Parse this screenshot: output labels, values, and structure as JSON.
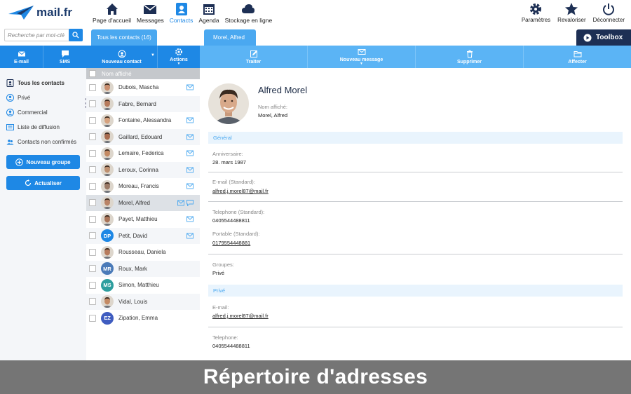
{
  "brand": {
    "name": "mail.fr",
    "accent": "#1e88e5",
    "dark": "#1d2f54"
  },
  "topnav": [
    {
      "label": "Page d'accueil",
      "icon": "home-icon"
    },
    {
      "label": "Messages",
      "icon": "envelope-icon"
    },
    {
      "label": "Contacts",
      "icon": "contacts-icon",
      "active": true
    },
    {
      "label": "Agenda",
      "icon": "calendar-icon"
    },
    {
      "label": "Stockage en ligne",
      "icon": "cloud-icon"
    }
  ],
  "topright": [
    {
      "label": "Paramètres",
      "icon": "gear-icon"
    },
    {
      "label": "Revaloriser",
      "icon": "star-icon"
    },
    {
      "label": "Déconnecter",
      "icon": "power-icon"
    }
  ],
  "search": {
    "placeholder": "Recherche par mot-clé"
  },
  "tabs": {
    "all_contacts": "Tous les contacts (16)",
    "current": "Morel, Alfred"
  },
  "toolbox": {
    "label": "Toolbox"
  },
  "toolbar_left": [
    {
      "label": "E-mail",
      "icon": "envelope-icon"
    },
    {
      "label": "SMS",
      "icon": "sms-icon"
    },
    {
      "label": "Nouveau contact",
      "icon": "add-contact-icon"
    },
    {
      "label": "Actions",
      "icon": "gear-icon"
    }
  ],
  "toolbar_right": [
    {
      "label": "Traiter",
      "icon": "edit-icon"
    },
    {
      "label": "Nouveau message",
      "icon": "envelope-icon"
    },
    {
      "label": "Supprimer",
      "icon": "trash-icon"
    },
    {
      "label": "Affecter",
      "icon": "folder-icon"
    }
  ],
  "sidebar": {
    "items": [
      {
        "label": "Tous les contacts",
        "icon": "address-book-icon"
      },
      {
        "label": "Privé",
        "icon": "user-circle-icon"
      },
      {
        "label": "Commercial",
        "icon": "user-circle-icon"
      },
      {
        "label": "Liste de diffusion",
        "icon": "list-icon"
      },
      {
        "label": "Contacts non confirmés",
        "icon": "users-icon"
      }
    ],
    "new_group": "Nouveau groupe",
    "refresh": "Actualiser"
  },
  "list": {
    "header": "Nom affiché",
    "rows": [
      {
        "name": "Dubois, Mascha",
        "initials": "",
        "mail": true
      },
      {
        "name": "Fabre, Bernard",
        "initials": "",
        "mail": false
      },
      {
        "name": "Fontaine, Alessandra",
        "initials": "",
        "mail": true
      },
      {
        "name": "Gaillard, Edouard",
        "initials": "",
        "mail": true
      },
      {
        "name": "Lemaire, Federica",
        "initials": "",
        "mail": true
      },
      {
        "name": "Leroux, Corinna",
        "initials": "",
        "mail": true
      },
      {
        "name": "Moreau, Francis",
        "initials": "",
        "mail": true
      },
      {
        "name": "Morel, Alfred",
        "initials": "",
        "mail": true
      },
      {
        "name": "Payet, Matthieu",
        "initials": "",
        "mail": true
      },
      {
        "name": "Petit, David",
        "initials": "DP",
        "mail": true
      },
      {
        "name": "Rousseau, Daniela",
        "initials": "",
        "mail": false
      },
      {
        "name": "Roux, Mark",
        "initials": "MR",
        "mail": false
      },
      {
        "name": "Simon, Matthieu",
        "initials": "MS",
        "mail": false
      },
      {
        "name": "Vidal, Louis",
        "initials": "",
        "mail": false
      },
      {
        "name": "Zipation, Emma",
        "initials": "EZ",
        "mail": false
      }
    ]
  },
  "detail": {
    "name": "Alfred Morel",
    "display_label": "Nom affiché:",
    "display_value": "Morel, Alfred",
    "general": "Général",
    "birthday_label": "Anniversaire:",
    "birthday_value": "28. mars 1987",
    "email_std_label": "E-mail (Standard):",
    "email_std_value": "alfred.j.morel87@mail.fr",
    "phone_std_label": "Telephone (Standard):",
    "phone_std_value": "0405544488811",
    "mobile_std_label": "Portable (Standard):",
    "mobile_std_value": "0179554448881",
    "groups_label": "Groupes:",
    "groups_value": "Privé",
    "private": "Privé",
    "email_label": "E-mail:",
    "email_value": "alfred.j.morel87@mail.fr",
    "phone_label": "Telephone:",
    "phone_value": "0405544488811"
  },
  "banner": {
    "text": "Répertoire d'adresses"
  }
}
